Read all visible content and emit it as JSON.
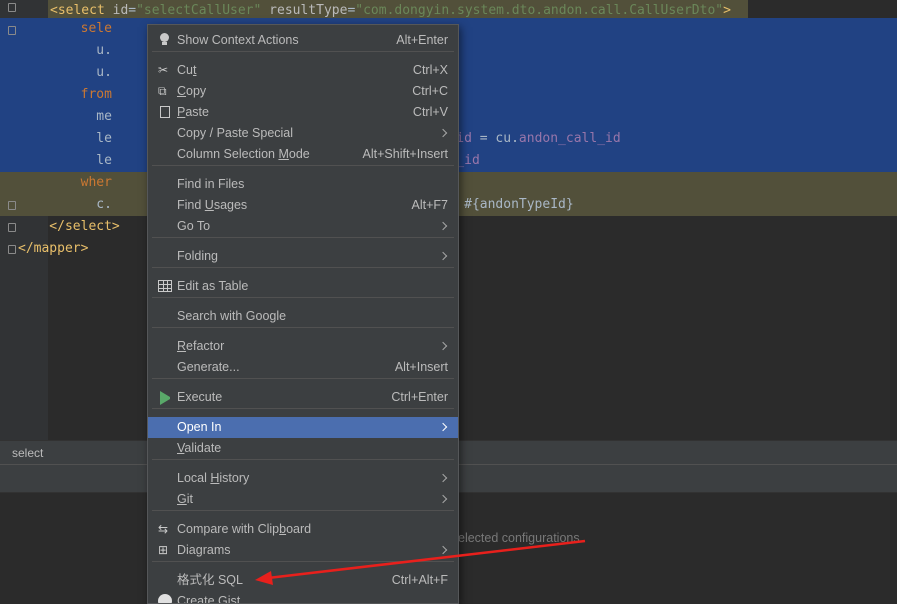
{
  "editor": {
    "lines": [
      {
        "parts": [
          {
            "t": "<select ",
            "c": "tag"
          },
          {
            "t": "id",
            "c": "attr"
          },
          {
            "t": "=",
            "c": ""
          },
          {
            "t": "\"selectCallUser\"",
            "c": "val"
          },
          {
            "t": " resultType",
            "c": "attr"
          },
          {
            "t": "=",
            "c": ""
          },
          {
            "t": "\"com.dongyin.system.dto.andon.call.CallUserDto\"",
            "c": "val"
          },
          {
            "t": ">",
            "c": "tag"
          }
        ]
      },
      {
        "parts": [
          {
            "t": "        sele",
            "c": "kw"
          }
        ]
      },
      {
        "parts": [
          {
            "t": "          u.",
            "c": ""
          }
        ]
      },
      {
        "parts": [
          {
            "t": "          u.",
            "c": ""
          }
        ]
      },
      {
        "parts": [
          {
            "t": "        from",
            "c": "kw"
          }
        ]
      },
      {
        "parts": [
          {
            "t": "          me",
            "c": ""
          }
        ]
      },
      {
        "parts": [
          {
            "t": "          le",
            "c": ""
          },
          {
            "t": "                                          l_id",
            "c": "col"
          },
          {
            "t": " = cu.",
            "c": ""
          },
          {
            "t": "andon_call_id",
            "c": "col"
          }
        ]
      },
      {
        "parts": [
          {
            "t": "          le",
            "c": ""
          },
          {
            "t": "                                          er_id",
            "c": "col"
          }
        ]
      },
      {
        "parts": [
          {
            "t": "        wher",
            "c": "kw"
          }
        ]
      },
      {
        "parts": [
          {
            "t": "          c.",
            "c": ""
          },
          {
            "t": "                                           = #{andonTypeId}",
            "c": ""
          }
        ]
      },
      {
        "parts": [
          {
            "t": "    </select>",
            "c": "tag"
          }
        ]
      },
      {
        "parts": [
          {
            "t": "</mapper>",
            "c": "tag"
          }
        ]
      }
    ]
  },
  "breadcrumb": "select",
  "bottom_hint": "elected configurations",
  "menu": {
    "items": [
      {
        "label": "Show Context Actions",
        "shortcut": "Alt+Enter",
        "icon": "bulb-icon"
      },
      {
        "label": "Cut",
        "shortcut": "Ctrl+X",
        "icon": "scissors-icon"
      },
      {
        "label": "Copy",
        "shortcut": "Ctrl+C",
        "icon": "copy-icon"
      },
      {
        "label": "Paste",
        "shortcut": "Ctrl+V",
        "icon": "paste-icon"
      },
      {
        "label": "Copy / Paste Special",
        "shortcut": "",
        "submenu": true
      },
      {
        "label": "Column Selection Mode",
        "shortcut": "Alt+Shift+Insert"
      },
      {
        "label": "Find in Files",
        "shortcut": ""
      },
      {
        "label": "Find Usages",
        "shortcut": "Alt+F7"
      },
      {
        "label": "Go To",
        "shortcut": "",
        "submenu": true
      },
      {
        "label": "Folding",
        "shortcut": "",
        "submenu": true
      },
      {
        "label": "Edit as Table",
        "shortcut": "",
        "icon": "table-icon"
      },
      {
        "label": "Search with Google",
        "shortcut": ""
      },
      {
        "label": "Refactor",
        "shortcut": "",
        "submenu": true
      },
      {
        "label": "Generate...",
        "shortcut": "Alt+Insert"
      },
      {
        "label": "Execute",
        "shortcut": "Ctrl+Enter",
        "icon": "run-icon"
      },
      {
        "label": "Open In",
        "shortcut": "",
        "submenu": true,
        "active": true
      },
      {
        "label": "Validate",
        "shortcut": ""
      },
      {
        "label": "Local History",
        "shortcut": "",
        "submenu": true
      },
      {
        "label": "Git",
        "shortcut": "",
        "submenu": true
      },
      {
        "label": "Compare with Clipboard",
        "shortcut": "",
        "icon": "compare-icon"
      },
      {
        "label": "Diagrams",
        "shortcut": "",
        "submenu": true,
        "icon": "diagram-icon"
      },
      {
        "label": "格式化 SQL",
        "shortcut": "Ctrl+Alt+F"
      },
      {
        "label": "Create Gist...",
        "shortcut": "",
        "icon": "github-icon"
      }
    ]
  },
  "colors": {
    "editor_bg": "#2b2b2b",
    "selection": "#214283",
    "menu_bg": "#3c3f41",
    "menu_active": "#4b6eaf",
    "annotation_arrow": "#e8201c"
  }
}
